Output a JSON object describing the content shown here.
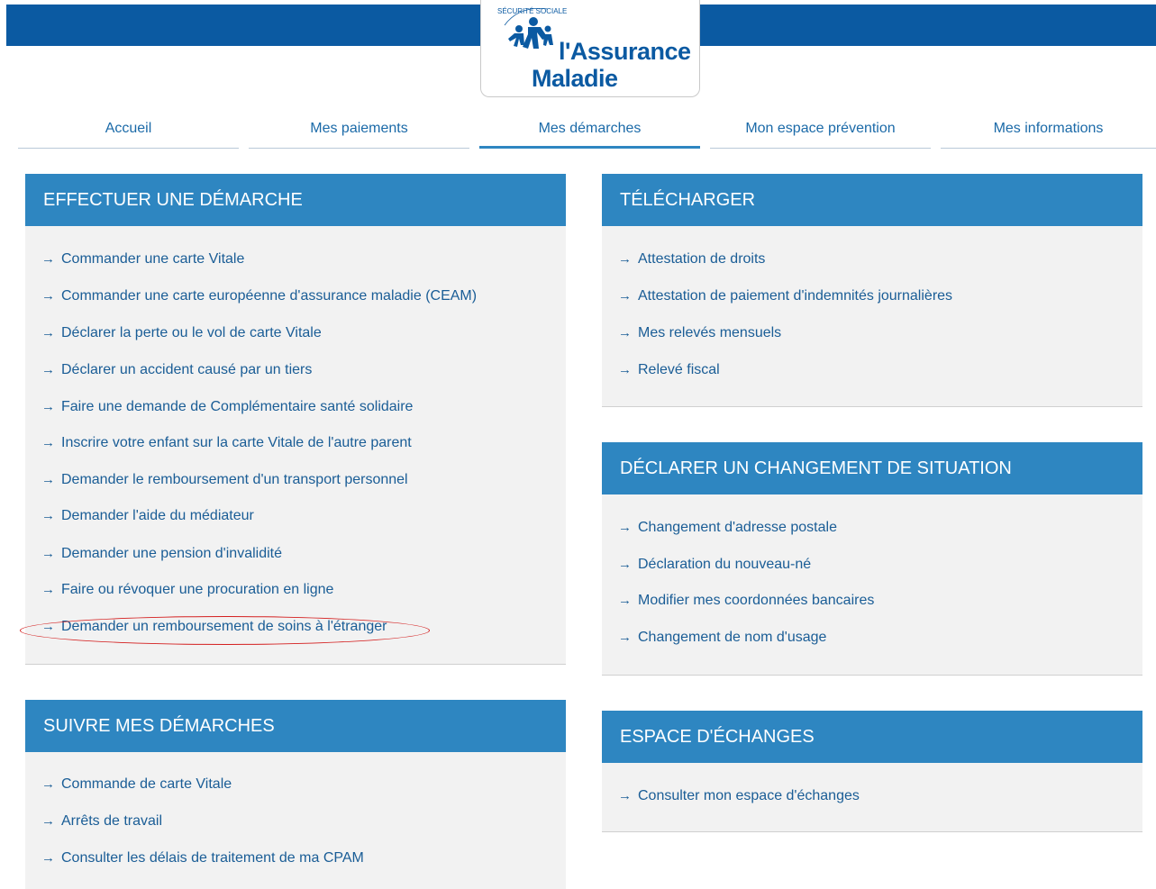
{
  "brand": {
    "arc_text": "SÉCURITÉ SOCIALE",
    "line1": "l'Assurance",
    "line2": "Maladie"
  },
  "nav": [
    {
      "label": "Accueil"
    },
    {
      "label": "Mes paiements"
    },
    {
      "label": "Mes démarches"
    },
    {
      "label": "Mon espace prévention"
    },
    {
      "label": "Mes informations"
    }
  ],
  "effectuer": {
    "title": "EFFECTUER UNE DÉMARCHE",
    "items": [
      "Commander une carte Vitale",
      "Commander une carte européenne d'assurance maladie (CEAM)",
      "Déclarer la perte ou le vol de carte Vitale",
      "Déclarer un accident causé par un tiers",
      "Faire une demande de Complémentaire santé solidaire",
      "Inscrire votre enfant sur la carte Vitale de l'autre parent",
      "Demander le remboursement d'un transport personnel",
      "Demander l'aide du médiateur",
      "Demander une pension d'invalidité",
      "Faire ou révoquer une procuration en ligne",
      "Demander un remboursement de soins à l'étranger"
    ]
  },
  "suivre": {
    "title": "SUIVRE MES DÉMARCHES",
    "items": [
      "Commande de carte Vitale",
      "Arrêts de travail",
      "Consulter les délais de traitement de ma CPAM"
    ]
  },
  "telecharger": {
    "title": "TÉLÉCHARGER",
    "items": [
      "Attestation de droits",
      "Attestation de paiement d'indemnités journalières",
      "Mes relevés mensuels",
      "Relevé fiscal"
    ]
  },
  "declarer": {
    "title": "DÉCLARER UN CHANGEMENT DE SITUATION",
    "items": [
      "Changement d'adresse postale",
      "Déclaration du nouveau-né",
      "Modifier mes coordonnées bancaires",
      "Changement de nom d'usage"
    ]
  },
  "echanges": {
    "title": "ESPACE D'ÉCHANGES",
    "items": [
      "Consulter mon espace d'échanges"
    ]
  },
  "colors": {
    "topbar": "#0b5aa2",
    "panel_header": "#2e86c1",
    "link": "#1a5d96",
    "highlight": "#d42020"
  },
  "icons": {
    "link_arrow": "arrow-right-icon",
    "logo_figures": "family-figures-icon"
  }
}
